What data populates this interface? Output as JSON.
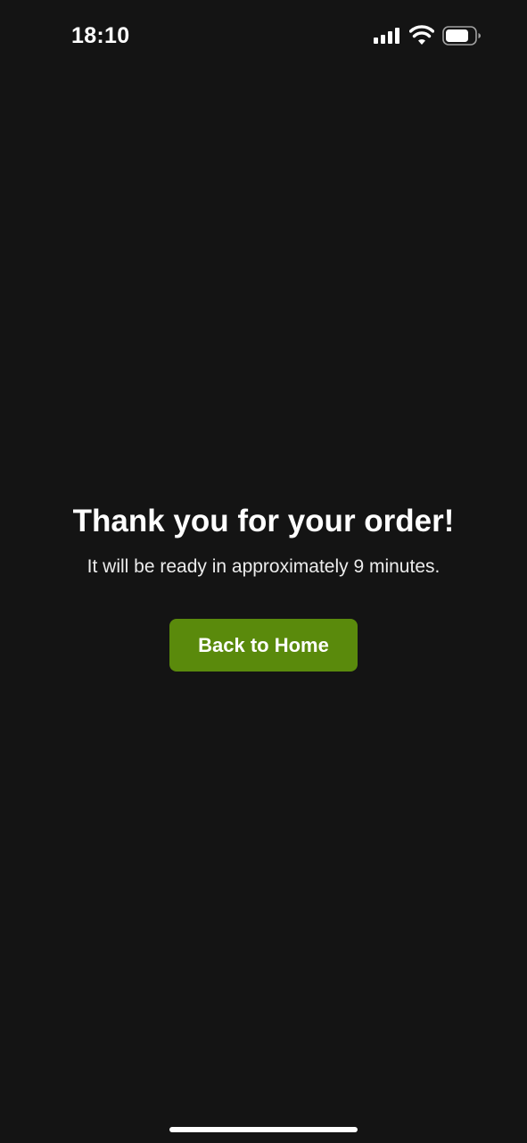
{
  "status_bar": {
    "time": "18:10",
    "icons": [
      "signal-icon",
      "wifi-icon",
      "battery-icon"
    ]
  },
  "confirmation": {
    "title": "Thank you for your order!",
    "message": "It will be ready in approximately 9 minutes."
  },
  "actions": {
    "home_button_label": "Back to Home"
  },
  "colors": {
    "background": "#141414",
    "accent": "#5a8a0c",
    "text": "#ffffff"
  }
}
